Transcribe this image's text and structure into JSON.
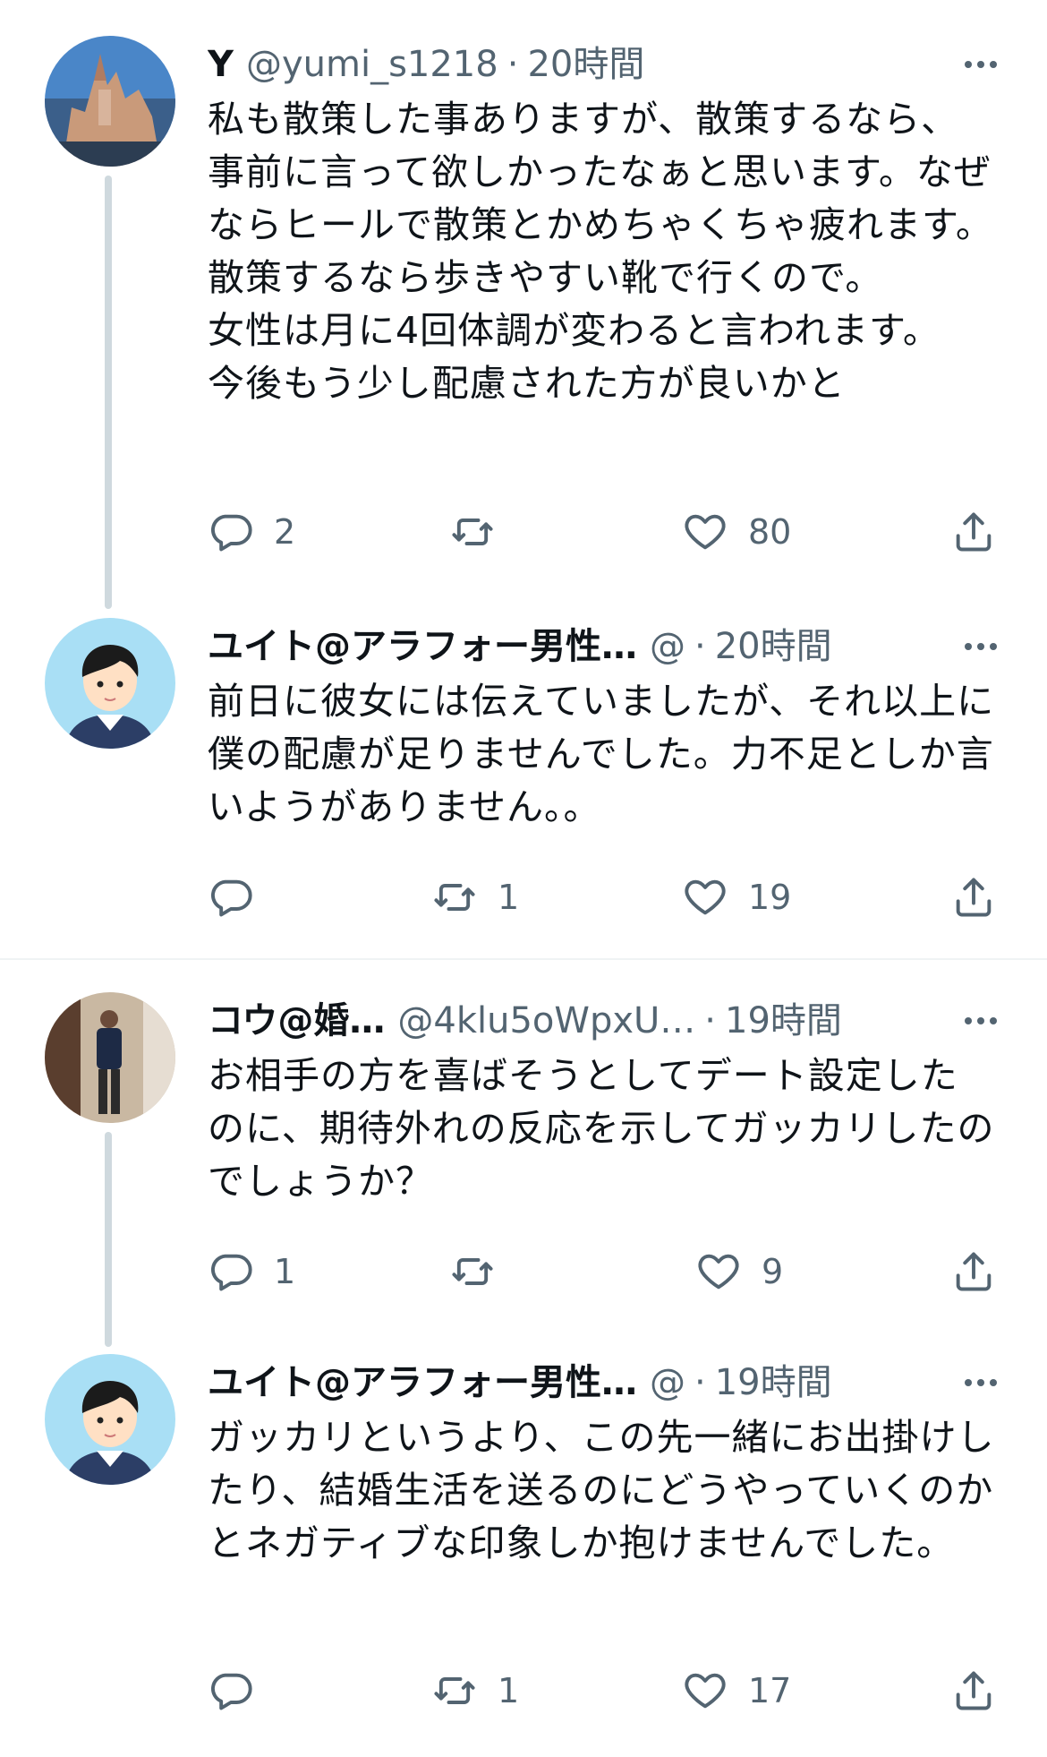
{
  "tweets": [
    {
      "name": "Y",
      "handle": "@yumi_s1218",
      "separator": "·",
      "time": "20時間",
      "body": "私も散策した事ありますが、散策するなら、事前に言って欲しかったなぁと思います。なぜならヒールで散策とかめちゃくちゃ疲れます。\n散策するなら歩きやすい靴で行くので。\n女性は月に4回体調が変わると言われます。\n今後もう少し配慮された方が良いかと",
      "reply_count": "2",
      "retweet_count": "",
      "like_count": "80"
    },
    {
      "name": "ユイト@アラフォー男性…",
      "handle": "@",
      "separator": "·",
      "time": "20時間",
      "body": "前日に彼女には伝えていましたが、それ以上に僕の配慮が足りませんでした。力不足としか言いようがありません。。",
      "reply_count": "",
      "retweet_count": "1",
      "like_count": "19"
    },
    {
      "name": "コウ@婚…",
      "handle": "@4klu5oWpxU…",
      "separator": "·",
      "time": "19時間",
      "body": "お相手の方を喜ばそうとしてデート設定したのに、期待外れの反応を示してガッカリしたのでしょうか？",
      "reply_count": "1",
      "retweet_count": "",
      "like_count": "9"
    },
    {
      "name": "ユイト@アラフォー男性…",
      "handle": "@",
      "separator": "·",
      "time": "19時間",
      "body": "ガッカリというより、この先一緒にお出掛けしたり、結婚生活を送るのにどうやっていくのかとネガティブな印象しか抱けませんでした。",
      "reply_count": "",
      "retweet_count": "1",
      "like_count": "17"
    }
  ],
  "icons": {
    "reply": "reply-icon",
    "retweet": "retweet-icon",
    "like": "heart-icon",
    "share": "share-icon",
    "more": "more-icon"
  },
  "colors": {
    "secondary_text": "#536471",
    "thread_line": "#cfd9de",
    "divider": "#eff3f4"
  }
}
